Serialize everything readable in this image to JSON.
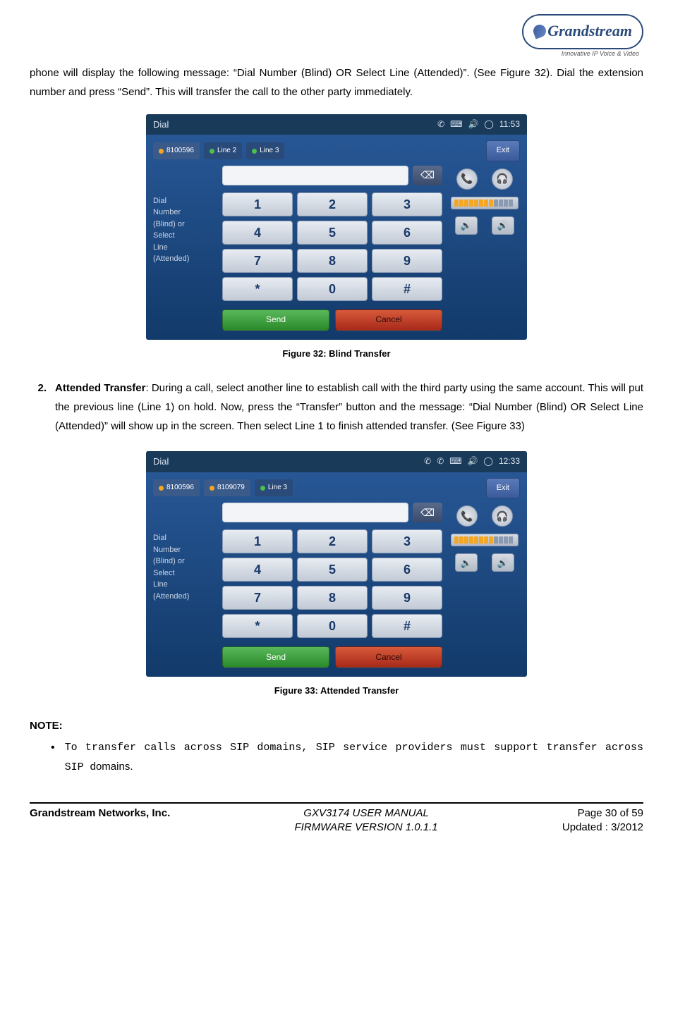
{
  "header": {
    "logo_text": "Grandstream",
    "tagline": "Innovative IP Voice & Video"
  },
  "intro_para": "phone will display the following message: “Dial Number (Blind) OR Select Line (Attended)”. (See Figure 32). Dial the extension number and press “Send”. This will transfer the call to the other party immediately.",
  "screenshot1": {
    "title": "Dial",
    "time": "11:53",
    "line1": "8100596",
    "line2": "Line 2",
    "line3": "Line 3",
    "exit": "Exit",
    "side_text": "Dial\nNumber\n(Blind) or\nSelect\nLine\n(Attended)",
    "keys": [
      "1",
      "2",
      "3",
      "4",
      "5",
      "6",
      "7",
      "8",
      "9",
      "*",
      "0",
      "#"
    ],
    "send": "Send",
    "cancel": "Cancel"
  },
  "fig1_caption": "Figure 32: Blind Transfer",
  "item2": {
    "num": "2.",
    "bold": "Attended Transfer",
    "rest": ": During a call, select another line to establish call with the third party using the same account. This will put the previous line (Line 1) on hold. Now, press the “Transfer” button and the message: “Dial Number (Blind) OR Select Line (Attended)” will show up in the screen. Then select Line 1 to finish attended transfer. (See Figure 33)"
  },
  "screenshot2": {
    "title": "Dial",
    "time": "12:33",
    "line1": "8100596",
    "line2": "8109079",
    "line3": "Line 3",
    "exit": "Exit",
    "side_text": "Dial\nNumber\n(Blind) or\nSelect\nLine\n(Attended)",
    "keys": [
      "1",
      "2",
      "3",
      "4",
      "5",
      "6",
      "7",
      "8",
      "9",
      "*",
      "0",
      "#"
    ],
    "send": "Send",
    "cancel": "Cancel"
  },
  "fig2_caption": "Figure 33: Attended Transfer",
  "note": {
    "head": "NOTE:",
    "item_mono": "To transfer calls across SIP domains, SIP service providers must support transfer across SIP ",
    "item_roman": "domains."
  },
  "footer": {
    "company": "Grandstream Networks, Inc.",
    "manual": "GXV3174 USER MANUAL",
    "fw": "FIRMWARE VERSION 1.0.1.1",
    "page": "Page 30 of 59",
    "updated": "Updated : 3/2012"
  }
}
